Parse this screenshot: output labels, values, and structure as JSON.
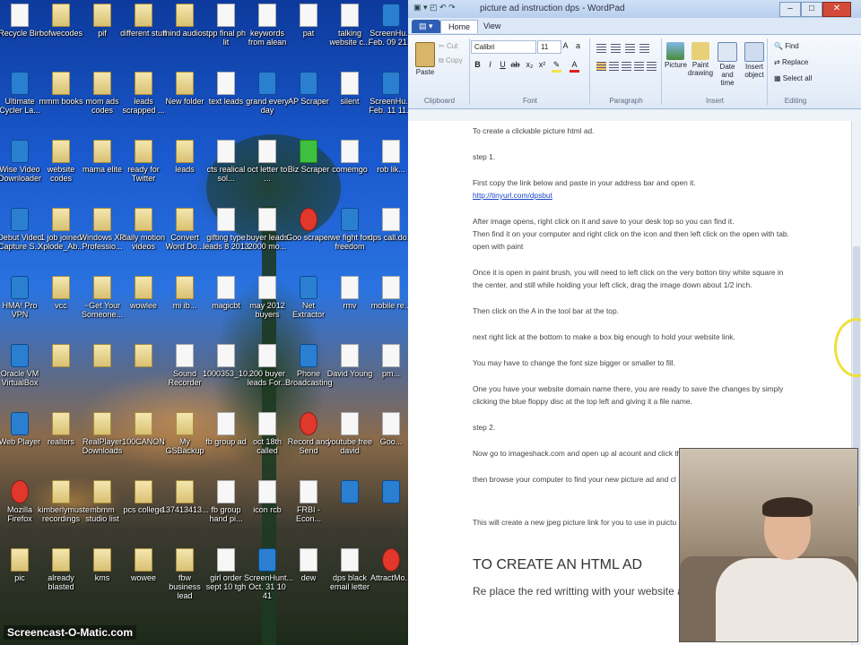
{
  "desktop": {
    "icons": [
      {
        "label": "Recycle Bin",
        "kind": "doc"
      },
      {
        "label": "bofwecodes",
        "kind": "folder"
      },
      {
        "label": "pif",
        "kind": "folder"
      },
      {
        "label": "different stuff",
        "kind": "folder"
      },
      {
        "label": "mind audios",
        "kind": "folder"
      },
      {
        "label": "tpp final ph lit",
        "kind": "doc"
      },
      {
        "label": "keywords from alean",
        "kind": "doc"
      },
      {
        "label": "pat",
        "kind": "doc"
      },
      {
        "label": "talking website c...",
        "kind": "doc"
      },
      {
        "label": "ScreenHu... Feb. 09 21...",
        "kind": "app"
      },
      {
        "label": "Ultimate Cycler La...",
        "kind": "app"
      },
      {
        "label": "mmm books",
        "kind": "folder"
      },
      {
        "label": "mom ads codes",
        "kind": "folder"
      },
      {
        "label": "leads scrapped ...",
        "kind": "folder"
      },
      {
        "label": "New folder",
        "kind": "folder"
      },
      {
        "label": "text leads",
        "kind": "doc"
      },
      {
        "label": "grand every day",
        "kind": "app"
      },
      {
        "label": "AP Scraper",
        "kind": "app"
      },
      {
        "label": "silent",
        "kind": "doc"
      },
      {
        "label": "ScreenHu... Feb. 11 11...",
        "kind": "app"
      },
      {
        "label": "Wise Video Downloader",
        "kind": "app"
      },
      {
        "label": "website codes",
        "kind": "folder"
      },
      {
        "label": "mama elite",
        "kind": "folder"
      },
      {
        "label": "ready for Twitter",
        "kind": "folder"
      },
      {
        "label": "leads",
        "kind": "folder"
      },
      {
        "label": "cts realical sol...",
        "kind": "doc"
      },
      {
        "label": "oct letter to ...",
        "kind": "doc"
      },
      {
        "label": "Biz Scraper",
        "kind": "green"
      },
      {
        "label": "comemgo",
        "kind": "doc"
      },
      {
        "label": "rob lik...",
        "kind": "doc"
      },
      {
        "label": "Debut Video Capture S...",
        "kind": "app"
      },
      {
        "label": "1 job joined Xplode_Ab...",
        "kind": "folder"
      },
      {
        "label": "Windows XP Professio...",
        "kind": "folder"
      },
      {
        "label": "daily motion videos",
        "kind": "folder"
      },
      {
        "label": "Convert Word Do...",
        "kind": "folder"
      },
      {
        "label": "gifting type leads 8 2013",
        "kind": "doc"
      },
      {
        "label": "buyer leads 2000 mo...",
        "kind": "doc"
      },
      {
        "label": "Goo scraper",
        "kind": "red"
      },
      {
        "label": "we fight for freedom",
        "kind": "app"
      },
      {
        "label": "dps call.do...",
        "kind": "doc"
      },
      {
        "label": "HMA! Pro VPN",
        "kind": "app"
      },
      {
        "label": "vcc",
        "kind": "folder"
      },
      {
        "label": "~Get Your Someone...",
        "kind": "folder"
      },
      {
        "label": "wowlee",
        "kind": "folder"
      },
      {
        "label": "mi ib...",
        "kind": "folder"
      },
      {
        "label": "magicbt",
        "kind": "doc"
      },
      {
        "label": "may 2012 buyers",
        "kind": "doc"
      },
      {
        "label": "Net Extractor",
        "kind": "app"
      },
      {
        "label": "rmv",
        "kind": "doc"
      },
      {
        "label": "mobile re...",
        "kind": "doc"
      },
      {
        "label": "Oracle VM VirtualBox",
        "kind": "app"
      },
      {
        "label": "",
        "kind": "folder"
      },
      {
        "label": "",
        "kind": "folder"
      },
      {
        "label": "",
        "kind": "folder"
      },
      {
        "label": "Sound Recorder",
        "kind": "doc"
      },
      {
        "label": "1000353_10...",
        "kind": "doc"
      },
      {
        "label": "200 buyer leads For...",
        "kind": "doc"
      },
      {
        "label": "Phone Broadcasting",
        "kind": "app"
      },
      {
        "label": "David Young",
        "kind": "doc"
      },
      {
        "label": "pm...",
        "kind": "doc"
      },
      {
        "label": "Web Player",
        "kind": "app"
      },
      {
        "label": "realtors",
        "kind": "folder"
      },
      {
        "label": "RealPlayer Downloads",
        "kind": "folder"
      },
      {
        "label": "100CANON",
        "kind": "folder"
      },
      {
        "label": "My GSBackup",
        "kind": "folder"
      },
      {
        "label": "fb group ad",
        "kind": "doc"
      },
      {
        "label": "oct 18th called",
        "kind": "doc"
      },
      {
        "label": "Record and Send",
        "kind": "red"
      },
      {
        "label": "youtube free david",
        "kind": "doc"
      },
      {
        "label": "Goo...",
        "kind": "doc"
      },
      {
        "label": "Mozilla Firefox",
        "kind": "red"
      },
      {
        "label": "kimberlymuste recordings",
        "kind": "folder"
      },
      {
        "label": "mbmm studio list",
        "kind": "folder"
      },
      {
        "label": "pcs college",
        "kind": "folder"
      },
      {
        "label": "137413413...",
        "kind": "folder"
      },
      {
        "label": "fb group hand pi...",
        "kind": "doc"
      },
      {
        "label": "icon rcb",
        "kind": "doc"
      },
      {
        "label": "FRBI - Econ...",
        "kind": "doc"
      },
      {
        "label": "",
        "kind": "app"
      },
      {
        "label": "",
        "kind": "app"
      },
      {
        "label": "pic",
        "kind": "folder"
      },
      {
        "label": "already blasted",
        "kind": "folder"
      },
      {
        "label": "kms",
        "kind": "folder"
      },
      {
        "label": "wowee",
        "kind": "folder"
      },
      {
        "label": "fbw business lead",
        "kind": "folder"
      },
      {
        "label": "girl order sept 10 tgh",
        "kind": "doc"
      },
      {
        "label": "ScreenHunt... Oct. 31 10 41",
        "kind": "app"
      },
      {
        "label": "dew",
        "kind": "doc"
      },
      {
        "label": "dps black email letter",
        "kind": "doc"
      },
      {
        "label": "AttractMo...",
        "kind": "red"
      }
    ],
    "watermark": "Screencast-O-Matic.com"
  },
  "wordpad": {
    "title": "picture ad instruction dps - WordPad",
    "tabs": {
      "file": "",
      "home": "Home",
      "view": "View"
    },
    "ribbon": {
      "paste": "Paste",
      "cut": "Cut",
      "copy": "Copy",
      "clipboard": "Clipboard",
      "font_name": "Calibri",
      "font_size": "11",
      "font_group": "Font",
      "paragraph_group": "Paragraph",
      "picture": "Picture",
      "paint_drawing": "Paint drawing",
      "date_time": "Date and time",
      "insert_object": "Insert object",
      "insert_group": "Insert",
      "find": "Find",
      "replace": "Replace",
      "select_all": "Select all",
      "editing_group": "Editing"
    },
    "document": {
      "line1": "To create a clickable picture html ad.",
      "step1": "step 1.",
      "p1": "First copy the link below and paste in your address bar and open it.",
      "link": "http://tinyurl.com/dpsbut",
      "p2a": "After image opens, right click on it and save to your desk top so you can find it.",
      "p2b": "Then find it on your computer and right click on the icon and then left click on the open with tab. open with paint",
      "p3": "Once it is open in paint brush, you will need to left click on the very botton tiny white square in the center, and still while holding your left click, drag the image down about 1/2 inch.",
      "p4": "Then click on the A in the tool bar at the top.",
      "p5": "next right lick at the bottom to make a box big enough to hold your website link.",
      "p6": "You may have to change the font size bigger or smaller to fill.",
      "p7": "One you have your website domain name there, you are ready to save the changes by simply clicking the blue floppy disc at the top left and giving it a file name.",
      "step2": "step 2.",
      "p8": "Now go to imageshack.com and open up al acount and click th",
      "p9": "then browse your computer to find your new picture ad and cl",
      "p10": "This will create a new jpeg picture link for you to use in puictu",
      "heading": "TO CREATE AN HTML AD",
      "p11": "Re place the red writting with your website address"
    }
  }
}
